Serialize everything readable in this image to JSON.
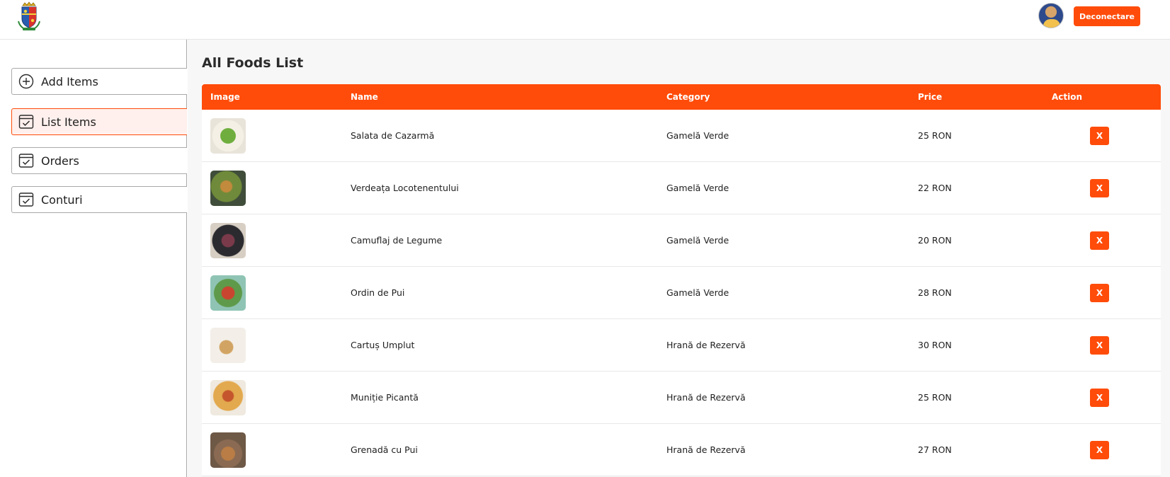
{
  "header": {
    "logout_label": "Deconectare",
    "accent": "#ff4c0a"
  },
  "sidebar": {
    "items": [
      {
        "label": "Add Items",
        "icon": "add-circle-icon",
        "active": false
      },
      {
        "label": "List Items",
        "icon": "checklist-icon",
        "active": true
      },
      {
        "label": "Orders",
        "icon": "checklist-icon",
        "active": false
      },
      {
        "label": "Conturi",
        "icon": "checklist-icon",
        "active": false
      }
    ]
  },
  "main": {
    "title": "All Foods List",
    "columns": [
      "Image",
      "Name",
      "Category",
      "Price",
      "Action"
    ],
    "delete_label": "X",
    "rows": [
      {
        "name": "Salata de Cazarmă",
        "category": "Gamelă Verde",
        "price": "25 RON"
      },
      {
        "name": "Verdeața Locotenentului",
        "category": "Gamelă Verde",
        "price": "22 RON"
      },
      {
        "name": "Camuflaj de Legume",
        "category": "Gamelă Verde",
        "price": "20 RON"
      },
      {
        "name": "Ordin de Pui",
        "category": "Gamelă Verde",
        "price": "28 RON"
      },
      {
        "name": "Cartuș Umplut",
        "category": "Hrană de Rezervă",
        "price": "30 RON"
      },
      {
        "name": "Muniție Picantă",
        "category": "Hrană de Rezervă",
        "price": "25 RON"
      },
      {
        "name": "Grenadă cu Pui",
        "category": "Hrană de Rezervă",
        "price": "27 RON"
      }
    ]
  }
}
